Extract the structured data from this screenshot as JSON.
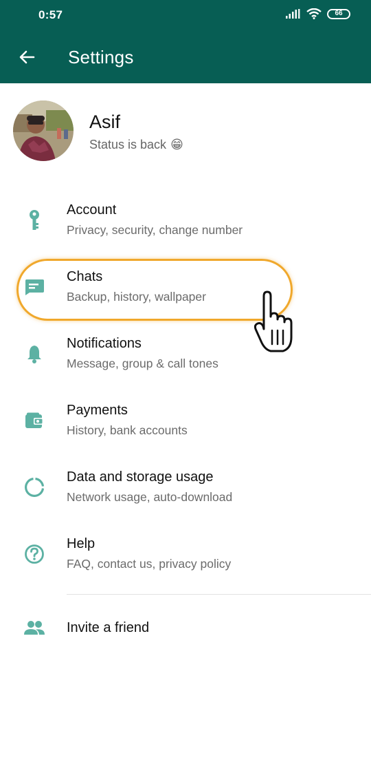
{
  "status_bar": {
    "time": "0:57",
    "battery": "66"
  },
  "app_bar": {
    "title": "Settings"
  },
  "profile": {
    "name": "Asif",
    "status": "Status is back",
    "status_emoji": "😁"
  },
  "menu": [
    {
      "title": "Account",
      "subtitle": "Privacy, security, change number",
      "icon": "key-icon"
    },
    {
      "title": "Chats",
      "subtitle": "Backup, history, wallpaper",
      "icon": "chat-icon"
    },
    {
      "title": "Notifications",
      "subtitle": "Message, group & call tones",
      "icon": "bell-icon"
    },
    {
      "title": "Payments",
      "subtitle": "History, bank accounts",
      "icon": "wallet-icon"
    },
    {
      "title": "Data and storage usage",
      "subtitle": "Network usage, auto-download",
      "icon": "data-usage-icon"
    },
    {
      "title": "Help",
      "subtitle": "FAQ, contact us, privacy policy",
      "icon": "help-icon"
    }
  ],
  "invite": {
    "title": "Invite a friend",
    "icon": "people-icon"
  },
  "colors": {
    "header": "#075e54",
    "icon_teal": "#5cb1a3",
    "highlight": "#f0a82c"
  }
}
